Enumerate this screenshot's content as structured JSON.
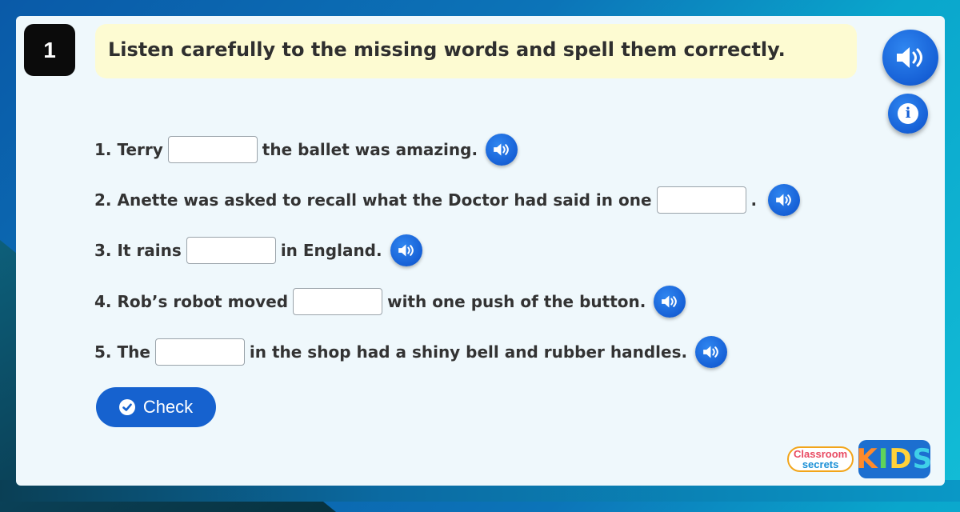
{
  "question": {
    "number": "1",
    "instruction": "Listen carefully to the missing words and spell them correctly."
  },
  "controls": {
    "main_audio_icon": "speaker-icon",
    "info_label": "i"
  },
  "sentences": [
    {
      "before": "1. Terry",
      "after": "the ballet was amazing.",
      "answer": ""
    },
    {
      "before": "2. Anette was asked to recall what the Doctor had said in one",
      "after": ".",
      "answer": ""
    },
    {
      "before": "3. It rains",
      "after": "in England.",
      "answer": ""
    },
    {
      "before": "4. Rob’s robot moved",
      "after": "with one push of the button.",
      "answer": ""
    },
    {
      "before": "5. The",
      "after": "in the shop had a shiny bell and rubber handles.",
      "answer": ""
    }
  ],
  "check_button": {
    "label": "Check"
  },
  "logo": {
    "line1": "Classroom",
    "line2": "secrets",
    "kids_letters": [
      "K",
      "I",
      "D",
      "S"
    ]
  },
  "colors": {
    "accent": "#1662cf",
    "instruction_bg": "#fdfbd2",
    "card_bg": "#eff8fc"
  }
}
